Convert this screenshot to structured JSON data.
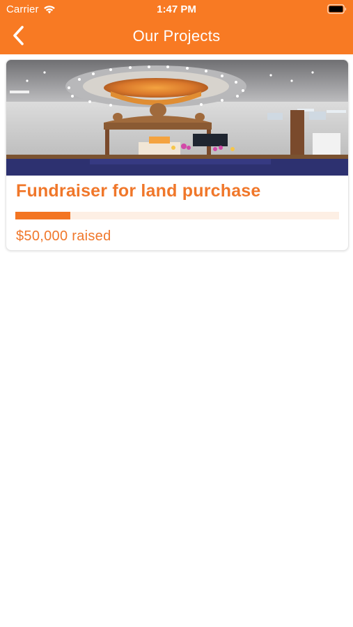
{
  "status_bar": {
    "carrier": "Carrier",
    "time": "1:47 PM",
    "wifi_icon": "wifi-icon",
    "battery_icon": "battery-full-icon"
  },
  "nav": {
    "back_icon": "chevron-left-icon",
    "title": "Our Projects"
  },
  "theme": {
    "accent": "#f87a23",
    "text_accent": "#f0772a",
    "progress_track": "#fdefe4",
    "background": "#ffffff"
  },
  "projects": [
    {
      "image": "temple-hall-interior-photo",
      "title": "Fundraiser for land purchase",
      "progress": 0.17,
      "raised_label": "$50,000 raised"
    }
  ]
}
